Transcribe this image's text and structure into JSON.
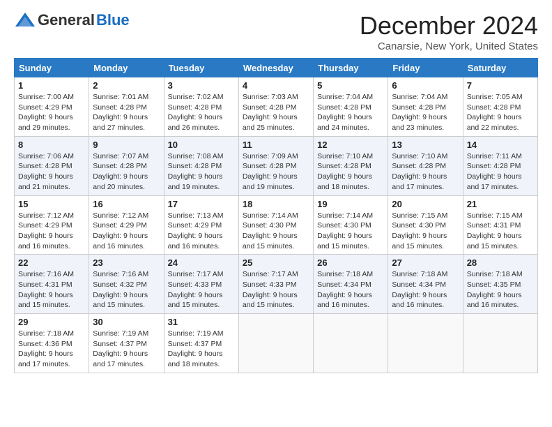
{
  "header": {
    "logo_general": "General",
    "logo_blue": "Blue",
    "month_title": "December 2024",
    "location": "Canarsie, New York, United States"
  },
  "days_of_week": [
    "Sunday",
    "Monday",
    "Tuesday",
    "Wednesday",
    "Thursday",
    "Friday",
    "Saturday"
  ],
  "weeks": [
    [
      {
        "day": 1,
        "sunrise": "Sunrise: 7:00 AM",
        "sunset": "Sunset: 4:29 PM",
        "daylight": "Daylight: 9 hours and 29 minutes."
      },
      {
        "day": 2,
        "sunrise": "Sunrise: 7:01 AM",
        "sunset": "Sunset: 4:28 PM",
        "daylight": "Daylight: 9 hours and 27 minutes."
      },
      {
        "day": 3,
        "sunrise": "Sunrise: 7:02 AM",
        "sunset": "Sunset: 4:28 PM",
        "daylight": "Daylight: 9 hours and 26 minutes."
      },
      {
        "day": 4,
        "sunrise": "Sunrise: 7:03 AM",
        "sunset": "Sunset: 4:28 PM",
        "daylight": "Daylight: 9 hours and 25 minutes."
      },
      {
        "day": 5,
        "sunrise": "Sunrise: 7:04 AM",
        "sunset": "Sunset: 4:28 PM",
        "daylight": "Daylight: 9 hours and 24 minutes."
      },
      {
        "day": 6,
        "sunrise": "Sunrise: 7:04 AM",
        "sunset": "Sunset: 4:28 PM",
        "daylight": "Daylight: 9 hours and 23 minutes."
      },
      {
        "day": 7,
        "sunrise": "Sunrise: 7:05 AM",
        "sunset": "Sunset: 4:28 PM",
        "daylight": "Daylight: 9 hours and 22 minutes."
      }
    ],
    [
      {
        "day": 8,
        "sunrise": "Sunrise: 7:06 AM",
        "sunset": "Sunset: 4:28 PM",
        "daylight": "Daylight: 9 hours and 21 minutes."
      },
      {
        "day": 9,
        "sunrise": "Sunrise: 7:07 AM",
        "sunset": "Sunset: 4:28 PM",
        "daylight": "Daylight: 9 hours and 20 minutes."
      },
      {
        "day": 10,
        "sunrise": "Sunrise: 7:08 AM",
        "sunset": "Sunset: 4:28 PM",
        "daylight": "Daylight: 9 hours and 19 minutes."
      },
      {
        "day": 11,
        "sunrise": "Sunrise: 7:09 AM",
        "sunset": "Sunset: 4:28 PM",
        "daylight": "Daylight: 9 hours and 19 minutes."
      },
      {
        "day": 12,
        "sunrise": "Sunrise: 7:10 AM",
        "sunset": "Sunset: 4:28 PM",
        "daylight": "Daylight: 9 hours and 18 minutes."
      },
      {
        "day": 13,
        "sunrise": "Sunrise: 7:10 AM",
        "sunset": "Sunset: 4:28 PM",
        "daylight": "Daylight: 9 hours and 17 minutes."
      },
      {
        "day": 14,
        "sunrise": "Sunrise: 7:11 AM",
        "sunset": "Sunset: 4:28 PM",
        "daylight": "Daylight: 9 hours and 17 minutes."
      }
    ],
    [
      {
        "day": 15,
        "sunrise": "Sunrise: 7:12 AM",
        "sunset": "Sunset: 4:29 PM",
        "daylight": "Daylight: 9 hours and 16 minutes."
      },
      {
        "day": 16,
        "sunrise": "Sunrise: 7:12 AM",
        "sunset": "Sunset: 4:29 PM",
        "daylight": "Daylight: 9 hours and 16 minutes."
      },
      {
        "day": 17,
        "sunrise": "Sunrise: 7:13 AM",
        "sunset": "Sunset: 4:29 PM",
        "daylight": "Daylight: 9 hours and 16 minutes."
      },
      {
        "day": 18,
        "sunrise": "Sunrise: 7:14 AM",
        "sunset": "Sunset: 4:30 PM",
        "daylight": "Daylight: 9 hours and 15 minutes."
      },
      {
        "day": 19,
        "sunrise": "Sunrise: 7:14 AM",
        "sunset": "Sunset: 4:30 PM",
        "daylight": "Daylight: 9 hours and 15 minutes."
      },
      {
        "day": 20,
        "sunrise": "Sunrise: 7:15 AM",
        "sunset": "Sunset: 4:30 PM",
        "daylight": "Daylight: 9 hours and 15 minutes."
      },
      {
        "day": 21,
        "sunrise": "Sunrise: 7:15 AM",
        "sunset": "Sunset: 4:31 PM",
        "daylight": "Daylight: 9 hours and 15 minutes."
      }
    ],
    [
      {
        "day": 22,
        "sunrise": "Sunrise: 7:16 AM",
        "sunset": "Sunset: 4:31 PM",
        "daylight": "Daylight: 9 hours and 15 minutes."
      },
      {
        "day": 23,
        "sunrise": "Sunrise: 7:16 AM",
        "sunset": "Sunset: 4:32 PM",
        "daylight": "Daylight: 9 hours and 15 minutes."
      },
      {
        "day": 24,
        "sunrise": "Sunrise: 7:17 AM",
        "sunset": "Sunset: 4:33 PM",
        "daylight": "Daylight: 9 hours and 15 minutes."
      },
      {
        "day": 25,
        "sunrise": "Sunrise: 7:17 AM",
        "sunset": "Sunset: 4:33 PM",
        "daylight": "Daylight: 9 hours and 15 minutes."
      },
      {
        "day": 26,
        "sunrise": "Sunrise: 7:18 AM",
        "sunset": "Sunset: 4:34 PM",
        "daylight": "Daylight: 9 hours and 16 minutes."
      },
      {
        "day": 27,
        "sunrise": "Sunrise: 7:18 AM",
        "sunset": "Sunset: 4:34 PM",
        "daylight": "Daylight: 9 hours and 16 minutes."
      },
      {
        "day": 28,
        "sunrise": "Sunrise: 7:18 AM",
        "sunset": "Sunset: 4:35 PM",
        "daylight": "Daylight: 9 hours and 16 minutes."
      }
    ],
    [
      {
        "day": 29,
        "sunrise": "Sunrise: 7:18 AM",
        "sunset": "Sunset: 4:36 PM",
        "daylight": "Daylight: 9 hours and 17 minutes."
      },
      {
        "day": 30,
        "sunrise": "Sunrise: 7:19 AM",
        "sunset": "Sunset: 4:37 PM",
        "daylight": "Daylight: 9 hours and 17 minutes."
      },
      {
        "day": 31,
        "sunrise": "Sunrise: 7:19 AM",
        "sunset": "Sunset: 4:37 PM",
        "daylight": "Daylight: 9 hours and 18 minutes."
      },
      null,
      null,
      null,
      null
    ]
  ]
}
